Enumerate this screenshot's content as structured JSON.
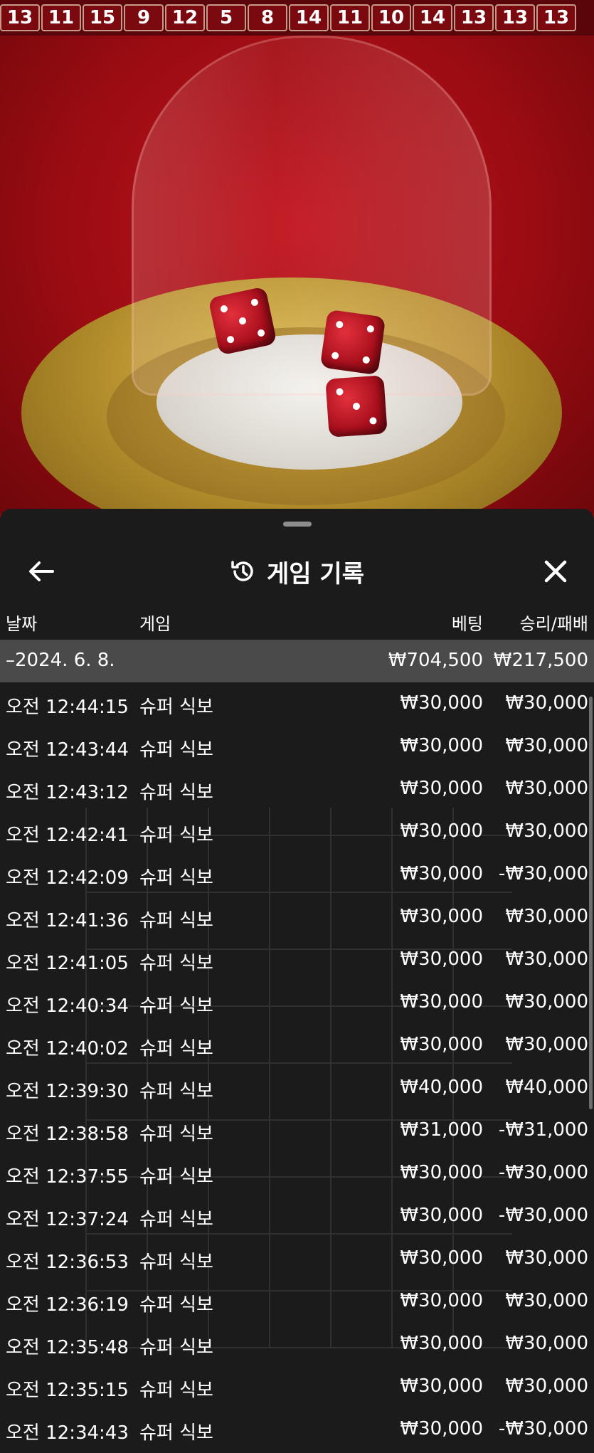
{
  "history_strip": [
    "13",
    "11",
    "15",
    "9",
    "12",
    "5",
    "8",
    "14",
    "11",
    "10",
    "14",
    "13",
    "13",
    "13"
  ],
  "sheet": {
    "title": "게임 기록",
    "back_icon": "arrow-left-icon",
    "history_icon": "history-clock-icon",
    "close_icon": "close-icon"
  },
  "columns": {
    "date": "날짜",
    "game": "게임",
    "bet": "베팅",
    "result": "승리/패배"
  },
  "summary": {
    "date": "–2024. 6. 8.",
    "bet": "₩704,500",
    "result": "₩217,500"
  },
  "rows": [
    {
      "time": "오전 12:44:15",
      "game": "슈퍼 식보",
      "bet": "₩30,000",
      "result": "₩30,000"
    },
    {
      "time": "오전 12:43:44",
      "game": "슈퍼 식보",
      "bet": "₩30,000",
      "result": "₩30,000"
    },
    {
      "time": "오전 12:43:12",
      "game": "슈퍼 식보",
      "bet": "₩30,000",
      "result": "₩30,000"
    },
    {
      "time": "오전 12:42:41",
      "game": "슈퍼 식보",
      "bet": "₩30,000",
      "result": "₩30,000"
    },
    {
      "time": "오전 12:42:09",
      "game": "슈퍼 식보",
      "bet": "₩30,000",
      "result": "-₩30,000"
    },
    {
      "time": "오전 12:41:36",
      "game": "슈퍼 식보",
      "bet": "₩30,000",
      "result": "₩30,000"
    },
    {
      "time": "오전 12:41:05",
      "game": "슈퍼 식보",
      "bet": "₩30,000",
      "result": "₩30,000"
    },
    {
      "time": "오전 12:40:34",
      "game": "슈퍼 식보",
      "bet": "₩30,000",
      "result": "₩30,000"
    },
    {
      "time": "오전 12:40:02",
      "game": "슈퍼 식보",
      "bet": "₩30,000",
      "result": "₩30,000"
    },
    {
      "time": "오전 12:39:30",
      "game": "슈퍼 식보",
      "bet": "₩40,000",
      "result": "₩40,000"
    },
    {
      "time": "오전 12:38:58",
      "game": "슈퍼 식보",
      "bet": "₩31,000",
      "result": "-₩31,000"
    },
    {
      "time": "오전 12:37:55",
      "game": "슈퍼 식보",
      "bet": "₩30,000",
      "result": "-₩30,000"
    },
    {
      "time": "오전 12:37:24",
      "game": "슈퍼 식보",
      "bet": "₩30,000",
      "result": "-₩30,000"
    },
    {
      "time": "오전 12:36:53",
      "game": "슈퍼 식보",
      "bet": "₩30,000",
      "result": "₩30,000"
    },
    {
      "time": "오전 12:36:19",
      "game": "슈퍼 식보",
      "bet": "₩30,000",
      "result": "₩30,000"
    },
    {
      "time": "오전 12:35:48",
      "game": "슈퍼 식보",
      "bet": "₩30,000",
      "result": "₩30,000"
    },
    {
      "time": "오전 12:35:15",
      "game": "슈퍼 식보",
      "bet": "₩30,000",
      "result": "₩30,000"
    },
    {
      "time": "오전 12:34:43",
      "game": "슈퍼 식보",
      "bet": "₩30,000",
      "result": "-₩30,000"
    }
  ]
}
